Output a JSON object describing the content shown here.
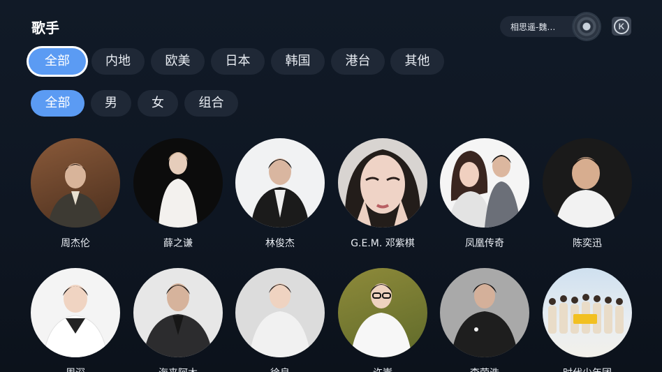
{
  "header": {
    "title": "歌手",
    "now_playing": "相思遥-魏…",
    "k_label": "K"
  },
  "region_tabs": [
    {
      "label": "全部",
      "active": true
    },
    {
      "label": "内地"
    },
    {
      "label": "欧美"
    },
    {
      "label": "日本"
    },
    {
      "label": "韩国"
    },
    {
      "label": "港台"
    },
    {
      "label": "其他"
    }
  ],
  "gender_tabs": [
    {
      "label": "全部",
      "active": true
    },
    {
      "label": "男"
    },
    {
      "label": "女"
    },
    {
      "label": "组合"
    }
  ],
  "artists": [
    {
      "name": "周杰伦"
    },
    {
      "name": "薛之谦"
    },
    {
      "name": "林俊杰"
    },
    {
      "name": "G.E.M. 邓紫棋"
    },
    {
      "name": "凤凰传奇"
    },
    {
      "name": "陈奕迅"
    },
    {
      "name": "周深"
    },
    {
      "name": "海来阿木"
    },
    {
      "name": "徐良"
    },
    {
      "name": "许嵩"
    },
    {
      "name": "李荣浩"
    },
    {
      "name": "时代少年团"
    }
  ],
  "colors": {
    "accent": "#5b9bf3",
    "pill_bg": "#1f2836",
    "background": "#0f1724"
  }
}
